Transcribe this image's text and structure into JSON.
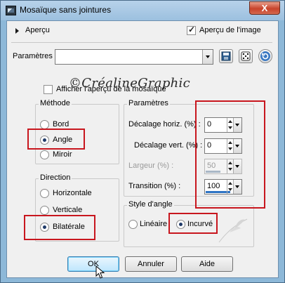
{
  "window": {
    "title": "Mosaïque sans jointures",
    "close_label": "X"
  },
  "preview": {
    "expander_label": "Aperçu",
    "show_image_label": "Aperçu de l'image",
    "show_image_checked": true
  },
  "presets": {
    "label": "Paramètres",
    "value": "",
    "watermark": "©CréalineGraphic"
  },
  "mosaic_preview": {
    "label": "Afficher l'aperçu de la mosaïque",
    "checked": false
  },
  "method": {
    "title": "Méthode",
    "options": [
      "Bord",
      "Angle",
      "Miroir"
    ],
    "selected": "Angle"
  },
  "params": {
    "title": "Paramètres",
    "fields": [
      {
        "label": "Décalage horiz. (%) :",
        "value": "0",
        "fill_percent": 0,
        "enabled": true
      },
      {
        "label": "Décalage vert. (%) :",
        "value": "0",
        "fill_percent": 0,
        "enabled": true
      },
      {
        "label": "Largeur (%) :",
        "value": "50",
        "fill_percent": 50,
        "enabled": false
      },
      {
        "label": "Transition (%) :",
        "value": "100",
        "fill_percent": 100,
        "enabled": true
      }
    ]
  },
  "direction": {
    "title": "Direction",
    "options": [
      "Horizontale",
      "Verticale",
      "Bilatérale"
    ],
    "selected": "Bilatérale"
  },
  "angle_style": {
    "title": "Style d'angle",
    "options": [
      "Linéaire",
      "Incurvé"
    ],
    "selected": "Incurvé"
  },
  "buttons": {
    "ok": "OK",
    "cancel": "Annuler",
    "help": "Aide"
  },
  "colors": {
    "highlight": "#c8161e",
    "accent": "#2f74c4",
    "window_frame": "#8db8d8"
  }
}
